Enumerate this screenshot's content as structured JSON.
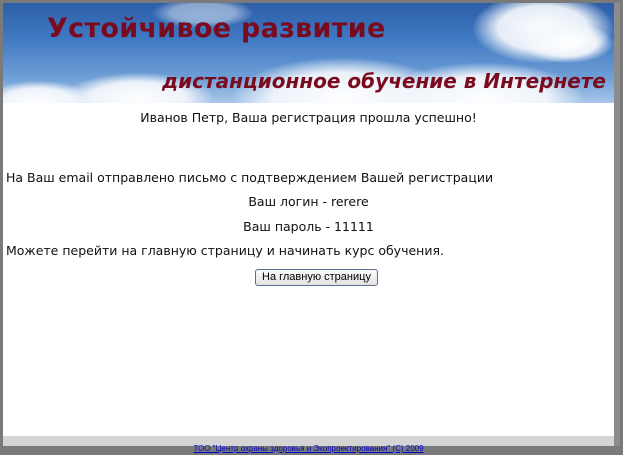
{
  "banner": {
    "title": "Устойчивое развитие",
    "subtitle": "дистанционное обучение в Интернете"
  },
  "main": {
    "success_message": "Иванов Петр, Ваша регистрация прошла успешно!",
    "email_notice": "На Ваш email отправлено письмо с подтверждением Вашей регистрации",
    "login_line": "Ваш логин - rerere",
    "password_line": "Ваш пароль - 11111",
    "next_step": "Можете перейти на главную страницу и начинать курс обучения.",
    "home_button_label": "На главную страницу"
  },
  "footer": {
    "copyright_link": "ТОО \"Центр охраны здоровья и Экопроектирования\" (С) 2009"
  },
  "colors": {
    "banner_text": "#7a0b1e",
    "sky": "#3f78c2",
    "link": "#0000cc"
  }
}
